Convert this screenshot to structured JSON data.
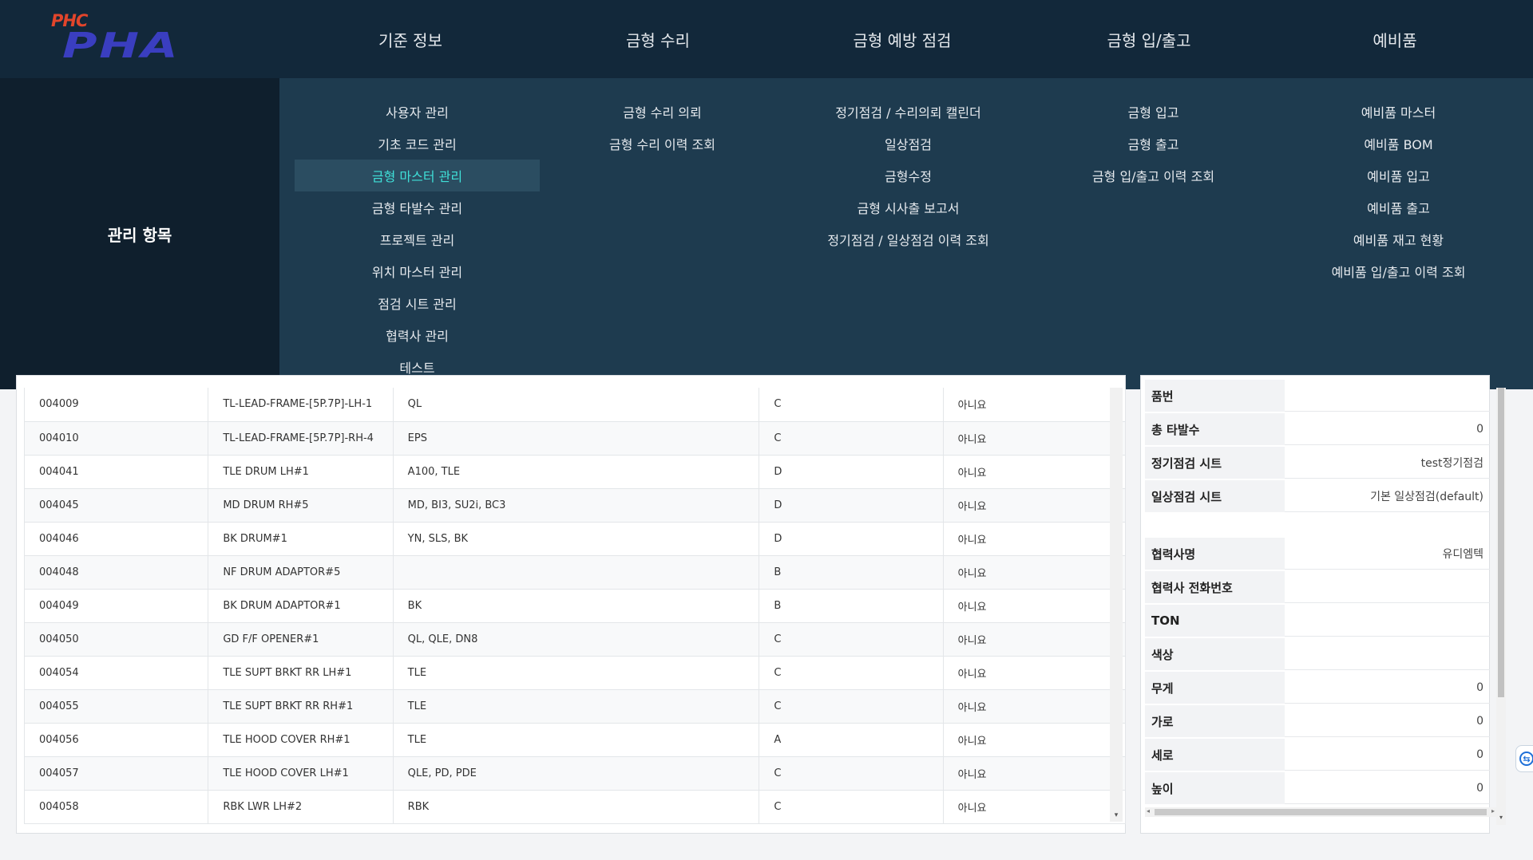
{
  "logo": {
    "top": "PHC",
    "main": "PHA"
  },
  "nav": [
    "기준 정보",
    "금형 수리",
    "금형 예방 점검",
    "금형 입/출고",
    "예비품"
  ],
  "mega_title": "관리 항목",
  "menus": [
    [
      "사용자 관리",
      "기초 코드 관리",
      "금형 마스터 관리",
      "금형 타발수 관리",
      "프로젝트 관리",
      "위치 마스터 관리",
      "점검 시트 관리",
      "협력사 관리",
      "테스트"
    ],
    [
      "금형 수리 의뢰",
      "금형 수리 이력 조회"
    ],
    [
      "정기점검 / 수리의뢰 캘린더",
      "일상점검",
      "금형수정",
      "금형 시사출 보고서",
      "정기점검 / 일상점검 이력 조회"
    ],
    [
      "금형 입고",
      "금형 출고",
      "금형 입/출고 이력 조회"
    ],
    [
      "예비품 마스터",
      "예비품 BOM",
      "예비품 입고",
      "예비품 출고",
      "예비품 재고 현황",
      "예비품 입/출고 이력 조회"
    ]
  ],
  "active_menu": "금형 마스터 관리",
  "table_rows": [
    [
      "004009",
      "TL-LEAD-FRAME-[5P.7P]-LH-1",
      "QL",
      "C",
      "아니요"
    ],
    [
      "004010",
      "TL-LEAD-FRAME-[5P.7P]-RH-4",
      "EPS",
      "C",
      "아니요"
    ],
    [
      "004041",
      "TLE DRUM LH#1",
      "A100, TLE",
      "D",
      "아니요"
    ],
    [
      "004045",
      "MD DRUM RH#5",
      "MD, BI3, SU2i, BC3",
      "D",
      "아니요"
    ],
    [
      "004046",
      "BK DRUM#1",
      "YN, SLS, BK",
      "D",
      "아니요"
    ],
    [
      "004048",
      "NF DRUM ADAPTOR#5",
      "",
      "B",
      "아니요"
    ],
    [
      "004049",
      "BK DRUM ADAPTOR#1",
      "BK",
      "B",
      "아니요"
    ],
    [
      "004050",
      "GD F/F OPENER#1",
      "QL, QLE, DN8",
      "C",
      "아니요"
    ],
    [
      "004054",
      "TLE SUPT BRKT RR LH#1",
      "TLE",
      "C",
      "아니요"
    ],
    [
      "004055",
      "TLE SUPT BRKT RR RH#1",
      "TLE",
      "C",
      "아니요"
    ],
    [
      "004056",
      "TLE HOOD COVER RH#1",
      "TLE",
      "A",
      "아니요"
    ],
    [
      "004057",
      "TLE HOOD COVER LH#1",
      "QLE, PD, PDE",
      "C",
      "아니요"
    ],
    [
      "004058",
      "RBK LWR LH#2",
      "RBK",
      "C",
      "아니요"
    ]
  ],
  "detail_top": [
    {
      "label": "품번",
      "value": ""
    },
    {
      "label": "총 타발수",
      "value": "0"
    },
    {
      "label": "정기점검 시트",
      "value": "test정기점검"
    },
    {
      "label": "일상점검 시트",
      "value": "기본 일상점검(default)"
    }
  ],
  "detail_bottom": [
    {
      "label": "협력사명",
      "value": "유디엠텍"
    },
    {
      "label": "협력사 전화번호",
      "value": ""
    },
    {
      "label": "TON",
      "value": ""
    },
    {
      "label": "색상",
      "value": ""
    },
    {
      "label": "무게",
      "value": "0"
    },
    {
      "label": "가로",
      "value": "0"
    },
    {
      "label": "세로",
      "value": "0"
    },
    {
      "label": "높이",
      "value": "0"
    }
  ],
  "icons": {
    "scroll_down": "▾",
    "scroll_left": "◂",
    "scroll_right": "▸",
    "remote": "⇆"
  },
  "colors": {
    "topbar": "#12283a",
    "menu_bg": "#1e3b4f",
    "active_text": "#3fe0d8"
  }
}
